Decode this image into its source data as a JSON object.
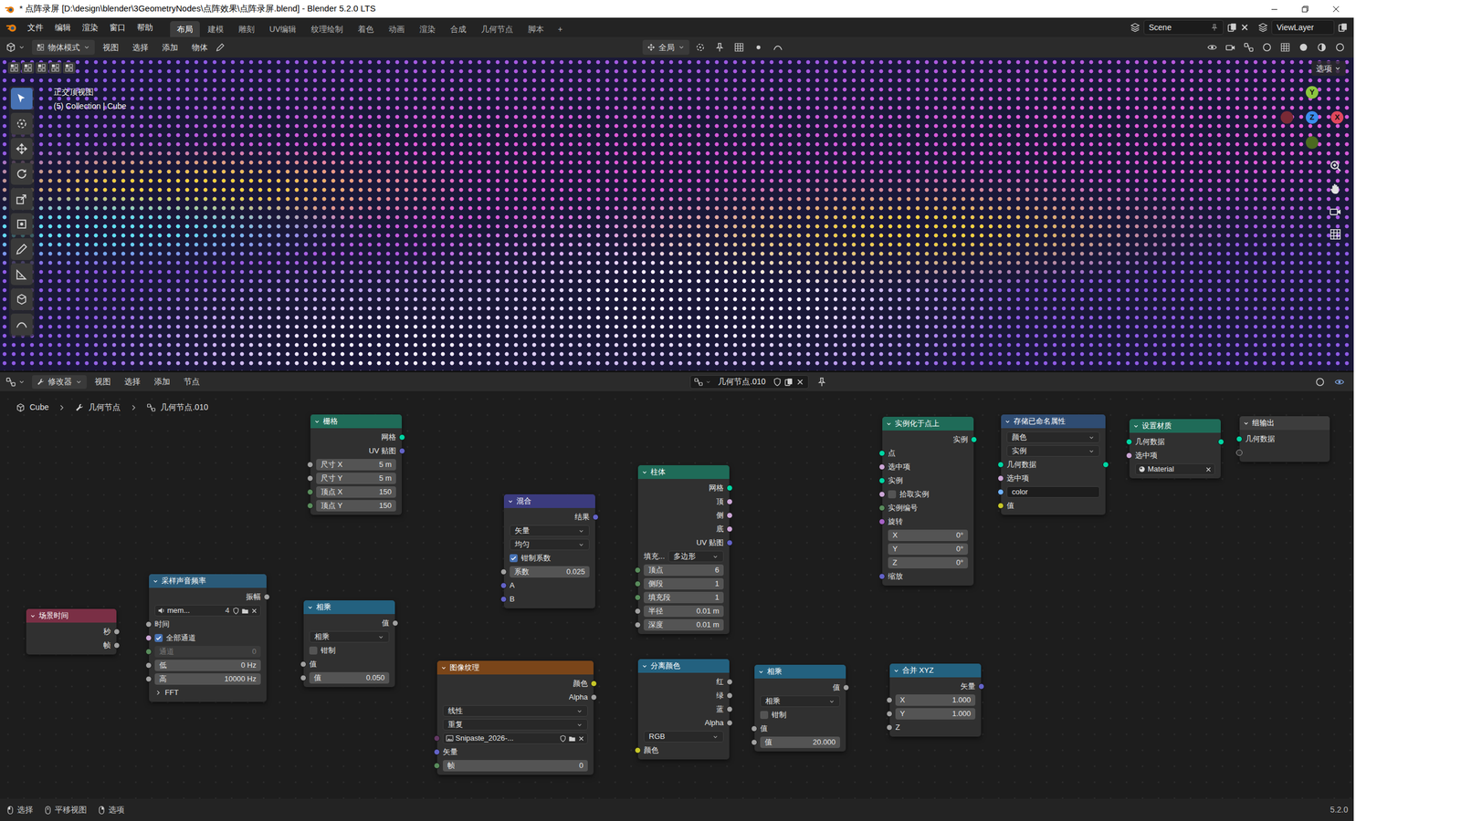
{
  "window": {
    "title": "* 点阵录屏 [D:\\design\\blender\\3GeometryNodes\\点阵效果\\点阵录屏.blend] - Blender 5.2.0 LTS"
  },
  "menus": [
    "文件",
    "编辑",
    "渲染",
    "窗口",
    "帮助"
  ],
  "workspaces": [
    {
      "label": "布局",
      "selected": true
    },
    {
      "label": "建模",
      "selected": false
    },
    {
      "label": "雕刻",
      "selected": false
    },
    {
      "label": "UV编辑",
      "selected": false
    },
    {
      "label": "纹理绘制",
      "selected": false
    },
    {
      "label": "着色",
      "selected": false
    },
    {
      "label": "动画",
      "selected": false
    },
    {
      "label": "渲染",
      "selected": false
    },
    {
      "label": "合成",
      "selected": false
    },
    {
      "label": "几何节点",
      "selected": false
    },
    {
      "label": "脚本",
      "selected": false
    }
  ],
  "add_workspace": "+",
  "scene": "Scene",
  "view_layer": "ViewLayer",
  "viewport_header": {
    "mode": "物体模式",
    "menus": [
      "视图",
      "选择",
      "添加",
      "物体"
    ],
    "orientation": "全局",
    "options": "选项"
  },
  "viewport": {
    "view_name": "正交顶视图",
    "collection": "(5) Collection | Cube",
    "toolbar": [
      {
        "selected": true
      },
      {
        "selected": false
      },
      {
        "selected": false
      },
      {
        "selected": false
      },
      {
        "selected": false
      },
      {
        "selected": false
      },
      {
        "selected": false
      },
      {
        "selected": false
      },
      {
        "selected": false
      },
      {
        "selected": false
      }
    ],
    "gizmo": [
      {
        "label": "Y",
        "color": "#8cc63f"
      },
      {
        "label": "Z",
        "color": "#3b8ded"
      },
      {
        "label": "X",
        "color": "#e0485e"
      }
    ]
  },
  "node_header": {
    "editor": "修改器",
    "menus": [
      "视图",
      "选择",
      "添加",
      "节点"
    ],
    "tree": "几何节点.010"
  },
  "breadcrumb": [
    "Cube",
    "几何节点",
    "几何节点.010"
  ],
  "nodes": [
    {
      "title": "栅格",
      "color": "#1f6b58",
      "rows": [
        {
          "kind": "out",
          "label": "网格",
          "socket": "#00d6a3"
        },
        {
          "kind": "out",
          "label": "UV 贴图",
          "socket": "#6363c7"
        },
        {
          "kind": "field",
          "label": "尺寸 X",
          "value": "5 m",
          "socket": "#a1a1a1",
          "disabled": false
        },
        {
          "kind": "field",
          "label": "尺寸 Y",
          "value": "5 m",
          "socket": "#a1a1a1",
          "disabled": false
        },
        {
          "kind": "field",
          "label": "顶点 X",
          "value": "150",
          "socket": "#598c5c",
          "disabled": false
        },
        {
          "kind": "field",
          "label": "顶点 Y",
          "value": "150",
          "socket": "#598c5c",
          "disabled": false
        }
      ]
    },
    {
      "title": "混合",
      "color": "#3b3b7e",
      "rows": [
        {
          "kind": "out",
          "label": "结果",
          "socket": "#6363c7"
        },
        {
          "kind": "select",
          "value": "矢量"
        },
        {
          "kind": "select",
          "value": "均匀"
        },
        {
          "kind": "check",
          "label": "钳制系数",
          "checked": true
        },
        {
          "kind": "field",
          "label": "系数",
          "value": "0.025",
          "socket": "#a1a1a1",
          "disabled": false
        },
        {
          "kind": "in",
          "label": "A",
          "socket": "#6363c7"
        },
        {
          "kind": "in",
          "label": "B",
          "socket": "#6363c7"
        }
      ]
    },
    {
      "title": "柱体",
      "color": "#1f6b58",
      "rows": [
        {
          "kind": "out",
          "label": "网格",
          "socket": "#00d6a3"
        },
        {
          "kind": "out",
          "label": "顶",
          "socket": "#cca6d6"
        },
        {
          "kind": "out",
          "label": "侧",
          "socket": "#cca6d6"
        },
        {
          "kind": "out",
          "label": "底",
          "socket": "#cca6d6"
        },
        {
          "kind": "out",
          "label": "UV 贴图",
          "socket": "#6363c7"
        },
        {
          "kind": "select",
          "label": "填充...",
          "value": "多边形"
        },
        {
          "kind": "field",
          "label": "顶点",
          "value": "6",
          "socket": "#598c5c",
          "disabled": false
        },
        {
          "kind": "field",
          "label": "侧段",
          "value": "1",
          "socket": "#598c5c",
          "disabled": false
        },
        {
          "kind": "field",
          "label": "填充段",
          "value": "1",
          "socket": "#598c5c",
          "disabled": false
        },
        {
          "kind": "field",
          "label": "半径",
          "value": "0.01 m",
          "socket": "#a1a1a1",
          "disabled": false
        },
        {
          "kind": "field",
          "label": "深度",
          "value": "0.01 m",
          "socket": "#a1a1a1",
          "disabled": false
        }
      ]
    },
    {
      "title": "实例化于点上",
      "color": "#1f6b58",
      "rows": [
        {
          "kind": "out",
          "label": "实例",
          "socket": "#00d6a3"
        },
        {
          "kind": "in",
          "label": "点",
          "socket": "#00d6a3"
        },
        {
          "kind": "in",
          "label": "选中项",
          "socket": "#cca6d6"
        },
        {
          "kind": "in",
          "label": "实例",
          "socket": "#00d6a3"
        },
        {
          "kind": "check",
          "label": "拾取实例",
          "checked": false,
          "socket": "#cca6d6"
        },
        {
          "kind": "in",
          "label": "实例编号",
          "socket": "#598c5c"
        },
        {
          "kind": "in",
          "label": "旋转",
          "socket": "#a663c7"
        },
        {
          "kind": "field",
          "label": "X",
          "value": "0°",
          "disabled": false
        },
        {
          "kind": "field",
          "label": "Y",
          "value": "0°",
          "disabled": false
        },
        {
          "kind": "field",
          "label": "Z",
          "value": "0°",
          "disabled": false
        },
        {
          "kind": "in",
          "label": "缩放",
          "socket": "#6363c7"
        }
      ]
    },
    {
      "title": "存储已命名属性",
      "color": "#2f4c72",
      "rows": [
        {
          "kind": "select",
          "value": "颜色"
        },
        {
          "kind": "select",
          "value": "实例"
        },
        {
          "kind": "inout",
          "label": "几何数据",
          "socket": "#00d6a3"
        },
        {
          "kind": "in",
          "label": "选中项",
          "socket": "#cca6d6"
        },
        {
          "kind": "text",
          "value": "color",
          "socket": "#70b2ff"
        },
        {
          "kind": "in",
          "label": "值",
          "socket": "#c7c729"
        }
      ]
    },
    {
      "title": "设置材质",
      "color": "#1f6b58",
      "rows": [
        {
          "kind": "inout",
          "label": "几何数据",
          "socket": "#00d6a3"
        },
        {
          "kind": "in",
          "label": "选中项",
          "socket": "#cca6d6"
        },
        {
          "kind": "data",
          "value": "Material"
        }
      ]
    },
    {
      "title": "组输出",
      "color": "#3d3d3d",
      "rows": [
        {
          "kind": "in",
          "label": "几何数据",
          "socket": "#00d6a3"
        },
        {
          "kind": "empty"
        }
      ]
    },
    {
      "title": "场景时间",
      "color": "#7a2f45",
      "rows": [
        {
          "kind": "out",
          "label": "秒",
          "socket": "#a1a1a1"
        },
        {
          "kind": "out",
          "label": "帧",
          "socket": "#a1a1a1"
        }
      ]
    },
    {
      "title": "采样声音频率",
      "color": "#2a5a78",
      "rows": [
        {
          "kind": "out",
          "label": "振幅",
          "socket": "#a1a1a1"
        },
        {
          "kind": "file",
          "value": "mem...",
          "count": "4"
        },
        {
          "kind": "in",
          "label": "时间",
          "socket": "#a1a1a1"
        },
        {
          "kind": "check",
          "label": "全部通道",
          "checked": true,
          "socket": "#cca6d6"
        },
        {
          "kind": "field",
          "label": "通道",
          "value": "0",
          "socket": "#598c5c",
          "disabled": true
        },
        {
          "kind": "field",
          "label": "低",
          "value": "0 Hz",
          "socket": "#a1a1a1",
          "disabled": false
        },
        {
          "kind": "field",
          "label": "高",
          "value": "10000 Hz",
          "socket": "#a1a1a1",
          "disabled": false
        },
        {
          "kind": "expander",
          "label": "FFT"
        }
      ]
    },
    {
      "title": "相乘",
      "color": "#23617f",
      "rows": [
        {
          "kind": "out",
          "label": "值",
          "socket": "#a1a1a1"
        },
        {
          "kind": "select",
          "value": "相乘"
        },
        {
          "kind": "check",
          "label": "钳制",
          "checked": false
        },
        {
          "kind": "in",
          "label": "值",
          "socket": "#a1a1a1"
        },
        {
          "kind": "field",
          "label": "值",
          "value": "0.050",
          "socket": "#a1a1a1",
          "disabled": false
        }
      ]
    },
    {
      "title": "图像纹理",
      "color": "#7a4519",
      "rows": [
        {
          "kind": "out",
          "label": "颜色",
          "socket": "#c7c729"
        },
        {
          "kind": "out",
          "label": "Alpha",
          "socket": "#a1a1a1"
        },
        {
          "kind": "select",
          "value": "线性"
        },
        {
          "kind": "select",
          "value": "重复"
        },
        {
          "kind": "file",
          "value": "Snipaste_2026-...",
          "socket": "#633863"
        },
        {
          "kind": "in",
          "label": "矢量",
          "socket": "#6363c7"
        },
        {
          "kind": "field",
          "label": "帧",
          "value": "0",
          "socket": "#598c5c",
          "disabled": false
        }
      ]
    },
    {
      "title": "分离颜色",
      "color": "#23617f",
      "rows": [
        {
          "kind": "out",
          "label": "红",
          "socket": "#a1a1a1"
        },
        {
          "kind": "out",
          "label": "绿",
          "socket": "#a1a1a1"
        },
        {
          "kind": "out",
          "label": "蓝",
          "socket": "#a1a1a1"
        },
        {
          "kind": "out",
          "label": "Alpha",
          "socket": "#a1a1a1"
        },
        {
          "kind": "select",
          "value": "RGB"
        },
        {
          "kind": "in",
          "label": "颜色",
          "socket": "#c7c729"
        }
      ]
    },
    {
      "title": "相乘",
      "color": "#23617f",
      "rows": [
        {
          "kind": "out",
          "label": "值",
          "socket": "#a1a1a1"
        },
        {
          "kind": "select",
          "value": "相乘"
        },
        {
          "kind": "check",
          "label": "钳制",
          "checked": false
        },
        {
          "kind": "in",
          "label": "值",
          "socket": "#a1a1a1"
        },
        {
          "kind": "field",
          "label": "值",
          "value": "20.000",
          "socket": "#a1a1a1",
          "disabled": false
        }
      ]
    },
    {
      "title": "合并 XYZ",
      "color": "#23617f",
      "rows": [
        {
          "kind": "out",
          "label": "矢量",
          "socket": "#6363c7"
        },
        {
          "kind": "field",
          "label": "X",
          "value": "1.000",
          "socket": "#a1a1a1",
          "disabled": false
        },
        {
          "kind": "field",
          "label": "Y",
          "value": "1.000",
          "socket": "#a1a1a1",
          "disabled": false
        },
        {
          "kind": "in",
          "label": "Z",
          "socket": "#a1a1a1"
        }
      ]
    }
  ],
  "links": [
    {
      "from": [
        0,
        0
      ],
      "to": [
        3,
        1
      ],
      "color": "#00d6a3"
    },
    {
      "from": [
        0,
        1
      ],
      "to": [
        1,
        5
      ],
      "color": "#6363c7"
    },
    {
      "from": [
        2,
        0
      ],
      "to": [
        3,
        3
      ],
      "color": "#00d6a3"
    },
    {
      "from": [
        7,
        0
      ],
      "to": [
        8,
        2
      ],
      "color": "#a1a1a1"
    },
    {
      "from": [
        8,
        0
      ],
      "to": [
        9,
        3
      ],
      "color": "#a1a1a1"
    },
    {
      "from": [
        9,
        0
      ],
      "to": [
        1,
        6
      ],
      "color": "#a1a1a1"
    },
    {
      "from": [
        1,
        0
      ],
      "to": [
        10,
        5
      ],
      "color": "#6363c7"
    },
    {
      "from": [
        10,
        0
      ],
      "to": [
        11,
        5
      ],
      "color": "#c7c729"
    },
    {
      "from": [
        10,
        0
      ],
      "to": [
        4,
        5
      ],
      "color": "#c7c729"
    },
    {
      "from": [
        11,
        0
      ],
      "to": [
        12,
        3
      ],
      "color": "#a1a1a1"
    },
    {
      "from": [
        12,
        0
      ],
      "to": [
        13,
        3
      ],
      "color": "#a1a1a1"
    },
    {
      "from": [
        13,
        0
      ],
      "to": [
        3,
        10
      ],
      "color": "#6363c7"
    },
    {
      "from": [
        3,
        0
      ],
      "to": [
        4,
        2
      ],
      "color": "#00d6a3"
    },
    {
      "from": [
        4,
        2
      ],
      "to": [
        5,
        0
      ],
      "color": "#00d6a3"
    },
    {
      "from": [
        5,
        0
      ],
      "to": [
        6,
        0
      ],
      "color": "#00d6a3"
    }
  ],
  "status_bar": {
    "hints": [
      "选择",
      "平移视图",
      "选项"
    ],
    "version": "5.2.0"
  }
}
